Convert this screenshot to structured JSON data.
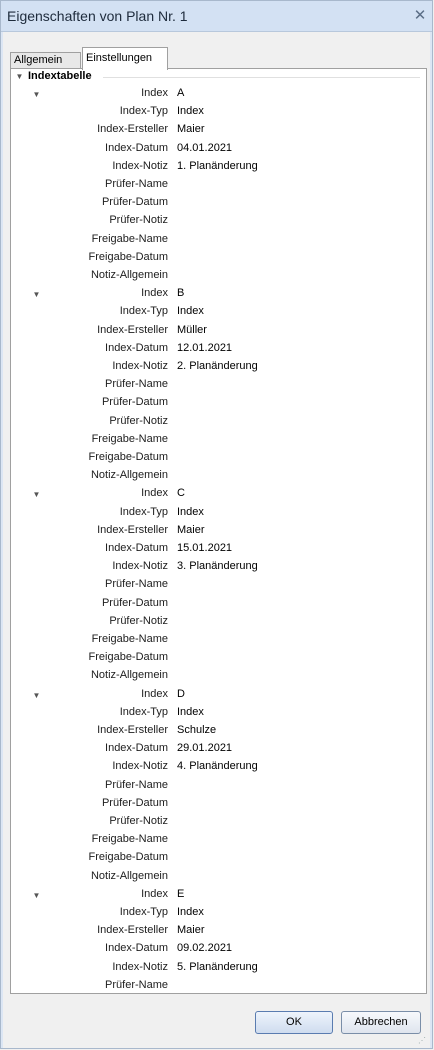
{
  "window": {
    "title": "Eigenschaften von Plan Nr. 1",
    "close_glyph": "✕"
  },
  "tabs": [
    {
      "label": "Allgemein"
    },
    {
      "label": "Einstellungen"
    }
  ],
  "group": {
    "label": "Indextabelle"
  },
  "field_labels": [
    "Index",
    "Index-Typ",
    "Index-Ersteller",
    "Index-Datum",
    "Index-Notiz",
    "Prüfer-Name",
    "Prüfer-Datum",
    "Prüfer-Notiz",
    "Freigabe-Name",
    "Freigabe-Datum",
    "Notiz-Allgemein"
  ],
  "entries": [
    {
      "values": [
        "A",
        "Index",
        "Maier",
        "04.01.2021",
        "1. Planänderung",
        "",
        "",
        "",
        "",
        "",
        ""
      ]
    },
    {
      "values": [
        "B",
        "Index",
        "Müller",
        "12.01.2021",
        "2. Planänderung",
        "",
        "",
        "",
        "",
        "",
        ""
      ]
    },
    {
      "values": [
        "C",
        "Index",
        "Maier",
        "15.01.2021",
        "3. Planänderung",
        "",
        "",
        "",
        "",
        "",
        ""
      ]
    },
    {
      "values": [
        "D",
        "Index",
        "Schulze",
        "29.01.2021",
        "4. Planänderung",
        "",
        "",
        "",
        "",
        "",
        ""
      ]
    },
    {
      "values": [
        "E",
        "Index",
        "Maier",
        "09.02.2021",
        "5. Planänderung",
        "",
        ""
      ]
    }
  ],
  "buttons": {
    "ok": "OK",
    "cancel": "Abbrechen"
  }
}
